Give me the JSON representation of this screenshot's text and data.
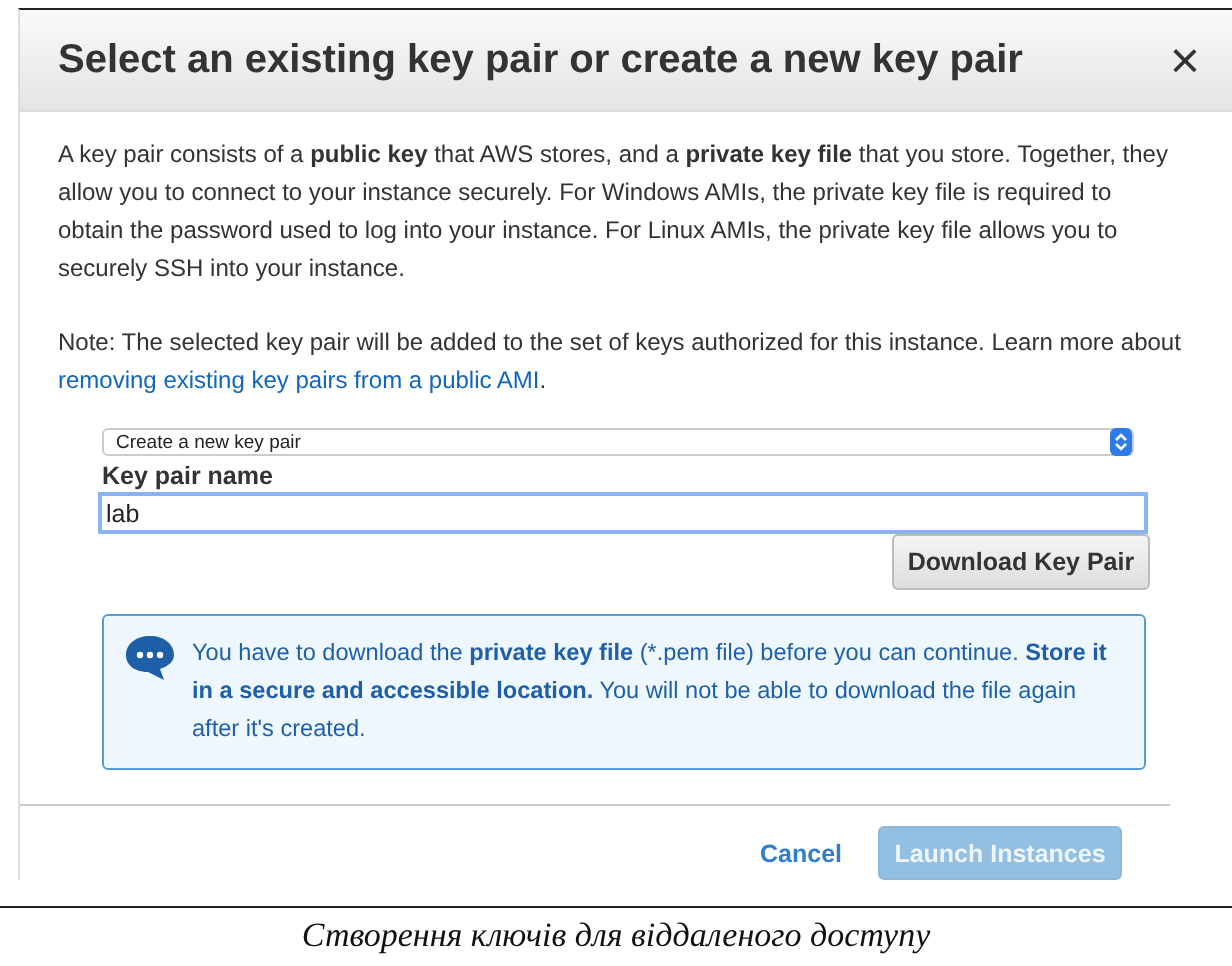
{
  "dialog": {
    "title": "Select an existing key pair or create a new key pair",
    "close": "×",
    "intro": "A key pair consists of a **public key** that AWS stores, and a **private key file** that you store. Together, they allow you to connect to your instance securely. For Windows AMIs, the private key file is required to obtain the password used to log into your instance. For Linux AMIs, the private key file allows you to securely SSH into your instance.",
    "note": "Note: The selected key pair will be added to the set of keys authorized for this instance. Learn more about",
    "note_link": "removing existing key pairs from a public AMI",
    "note_end": ".",
    "key_pair_mode": {
      "value": "Create a new key pair"
    },
    "name_field": {
      "label": "Key pair name",
      "value": "lab",
      "focused": true
    },
    "download_button": {
      "label": "Download Key Pair"
    },
    "info": "You have to download the **private key file** (*.pem file) before you can continue. **Store it in a secure and accessible location.** You will not be able to download the file again after it's created.",
    "cancel": "Cancel",
    "launch_button": {
      "label": "Launch Instances",
      "disabled": true
    }
  },
  "caption": "Створення ключів для віддаленого доступу"
}
